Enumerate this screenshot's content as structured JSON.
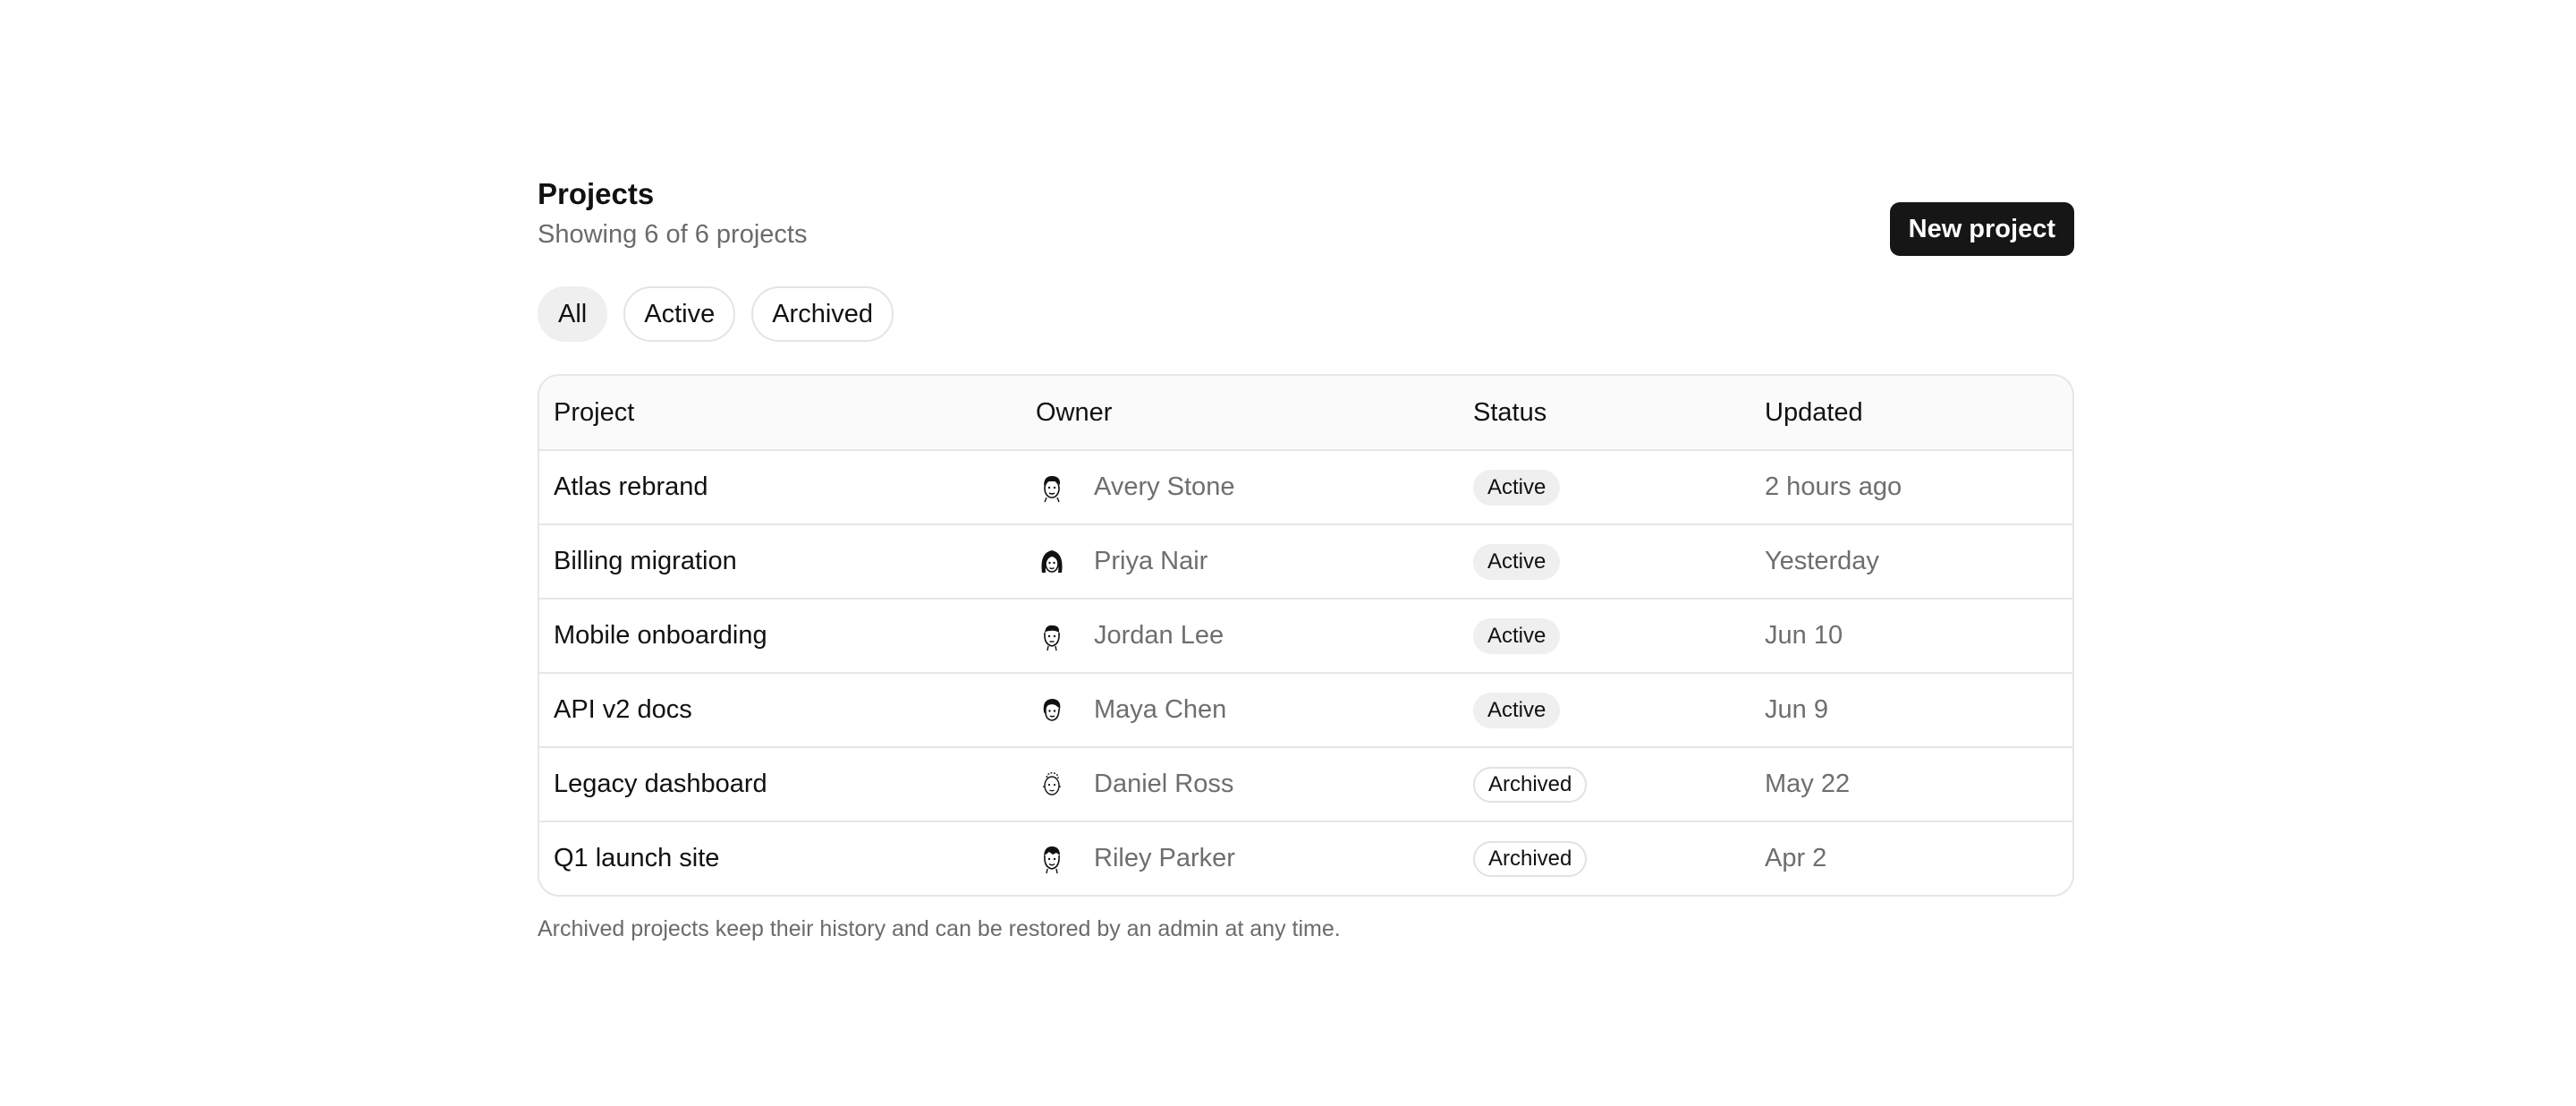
{
  "header": {
    "title": "Projects",
    "subtitle": "Showing 6 of 6 projects",
    "new_button_label": "New project"
  },
  "filters": [
    {
      "label": "All",
      "selected": true
    },
    {
      "label": "Active",
      "selected": false
    },
    {
      "label": "Archived",
      "selected": false
    }
  ],
  "table": {
    "columns": {
      "project": "Project",
      "owner": "Owner",
      "status": "Status",
      "updated": "Updated"
    },
    "rows": [
      {
        "project": "Atlas rebrand",
        "owner": "Avery Stone",
        "avatar": "avatar-icon",
        "status": "Active",
        "updated": "2 hours ago"
      },
      {
        "project": "Billing migration",
        "owner": "Priya Nair",
        "avatar": "avatar-icon",
        "status": "Active",
        "updated": "Yesterday"
      },
      {
        "project": "Mobile onboarding",
        "owner": "Jordan Lee",
        "avatar": "avatar-icon",
        "status": "Active",
        "updated": "Jun 10"
      },
      {
        "project": "API v2 docs",
        "owner": "Maya Chen",
        "avatar": "avatar-icon",
        "status": "Active",
        "updated": "Jun 9"
      },
      {
        "project": "Legacy dashboard",
        "owner": "Daniel Ross",
        "avatar": "avatar-icon",
        "status": "Archived",
        "updated": "May 22"
      },
      {
        "project": "Q1 launch site",
        "owner": "Riley Parker",
        "avatar": "avatar-icon",
        "status": "Archived",
        "updated": "Apr 2"
      }
    ]
  },
  "footnote": "Archived projects keep their history and can be restored by an admin at any time.",
  "colors": {
    "primary_button": "#161616",
    "muted_text": "#6e6e6e",
    "border": "#e6e6e6"
  }
}
